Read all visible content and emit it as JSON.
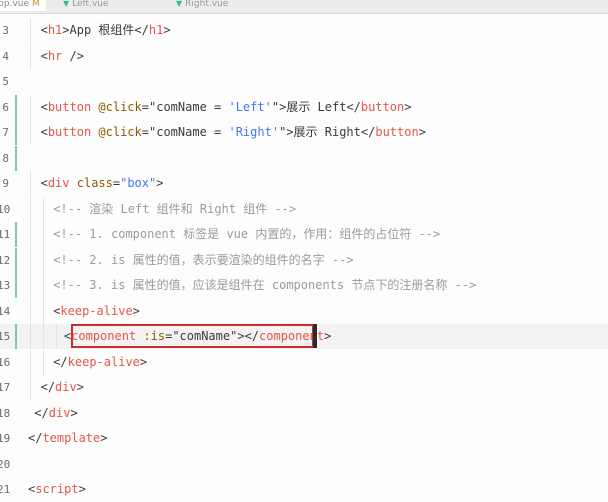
{
  "tabs": [
    {
      "name": "App.vue",
      "modified": "M"
    },
    {
      "name": "Left.vue"
    },
    {
      "name": "Right.vue"
    }
  ],
  "lines": [
    {
      "num": "3",
      "indent": 1,
      "tokens": [
        [
          "br",
          "<"
        ],
        [
          "tag",
          "h1"
        ],
        [
          "br",
          ">"
        ],
        [
          "txt",
          "App 根组件"
        ],
        [
          "br",
          "</"
        ],
        [
          "tag",
          "h1"
        ],
        [
          "br",
          ">"
        ]
      ]
    },
    {
      "num": "4",
      "indent": 1,
      "tokens": [
        [
          "br",
          "<"
        ],
        [
          "tag",
          "hr"
        ],
        [
          "br",
          " />"
        ]
      ]
    },
    {
      "num": "5",
      "indent": 0,
      "tokens": []
    },
    {
      "num": "6",
      "indent": 1,
      "tokens": [
        [
          "br",
          "<"
        ],
        [
          "tag",
          "button"
        ],
        [
          "attr",
          " @click"
        ],
        [
          "br",
          "="
        ],
        [
          "dq",
          "\"comName = "
        ],
        [
          "str",
          "'Left'"
        ],
        [
          "dq",
          "\""
        ],
        [
          "br",
          ">"
        ],
        [
          "txt",
          "展示 Left"
        ],
        [
          "br",
          "</"
        ],
        [
          "tag",
          "button"
        ],
        [
          "br",
          ">"
        ]
      ]
    },
    {
      "num": "7",
      "indent": 1,
      "tokens": [
        [
          "br",
          "<"
        ],
        [
          "tag",
          "button"
        ],
        [
          "attr",
          " @click"
        ],
        [
          "br",
          "="
        ],
        [
          "dq",
          "\"comName = "
        ],
        [
          "str",
          "'Right'"
        ],
        [
          "dq",
          "\""
        ],
        [
          "br",
          ">"
        ],
        [
          "txt",
          "展示 Right"
        ],
        [
          "br",
          "</"
        ],
        [
          "tag",
          "button"
        ],
        [
          "br",
          ">"
        ]
      ]
    },
    {
      "num": "8",
      "indent": 0,
      "tokens": []
    },
    {
      "num": "9",
      "indent": 1,
      "tokens": [
        [
          "br",
          "<"
        ],
        [
          "tag",
          "div"
        ],
        [
          "attr",
          " class"
        ],
        [
          "br",
          "="
        ],
        [
          "str",
          "\"box\""
        ],
        [
          "br",
          ">"
        ]
      ]
    },
    {
      "num": "10",
      "indent": 2,
      "tokens": [
        [
          "com",
          "<!-- 渲染 Left 组件和 Right 组件 -->"
        ]
      ]
    },
    {
      "num": "11",
      "indent": 2,
      "tokens": [
        [
          "com",
          "<!-- 1. component 标签是 vue 内置的，作用：组件的占位符 -->"
        ]
      ]
    },
    {
      "num": "12",
      "indent": 2,
      "tokens": [
        [
          "com",
          "<!-- 2. is 属性的值，表示要渲染的组件的名字 -->"
        ]
      ]
    },
    {
      "num": "13",
      "indent": 2,
      "tokens": [
        [
          "com",
          "<!-- 3. is 属性的值，应该是组件在 components 节点下的注册名称 -->"
        ]
      ]
    },
    {
      "num": "14",
      "indent": 2,
      "tokens": [
        [
          "br",
          "<"
        ],
        [
          "tag",
          "keep-alive"
        ],
        [
          "br",
          ">"
        ]
      ]
    },
    {
      "num": "15",
      "indent": 3,
      "tokens": [
        [
          "br",
          "<"
        ],
        [
          "tag",
          "component"
        ],
        [
          "attr",
          " :is"
        ],
        [
          "br",
          "="
        ],
        [
          "dq",
          "\"comName\""
        ],
        [
          "br",
          "></"
        ],
        [
          "tag",
          "component"
        ],
        [
          "br",
          ">"
        ]
      ]
    },
    {
      "num": "16",
      "indent": 2,
      "tokens": [
        [
          "br",
          "</"
        ],
        [
          "tag",
          "keep-alive"
        ],
        [
          "br",
          ">"
        ]
      ]
    },
    {
      "num": "17",
      "indent": 1,
      "tokens": [
        [
          "br",
          "</"
        ],
        [
          "tag",
          "div"
        ],
        [
          "br",
          ">"
        ]
      ]
    },
    {
      "num": "18",
      "indent": 0.5,
      "tokens": [
        [
          "br",
          "</"
        ],
        [
          "tag",
          "div"
        ],
        [
          "br",
          ">"
        ]
      ]
    },
    {
      "num": "19",
      "indent": 0,
      "tokens": [
        [
          "br",
          "</"
        ],
        [
          "tag",
          "template"
        ],
        [
          "br",
          ">"
        ]
      ]
    },
    {
      "num": "20",
      "indent": 0,
      "tokens": []
    },
    {
      "num": "21",
      "indent": 0,
      "tokens": [
        [
          "br",
          "<"
        ],
        [
          "tag",
          "script"
        ],
        [
          "br",
          ">"
        ]
      ]
    }
  ],
  "git_modified_lines": [
    "6",
    "7",
    "8",
    "11",
    "12",
    "13",
    "15"
  ],
  "current_line": "15",
  "colors": {
    "tag": "#e45649",
    "string": "#4078f2",
    "attribute": "#8f5902",
    "comment": "#9b9b9b",
    "highlight": "#d02a2a"
  }
}
